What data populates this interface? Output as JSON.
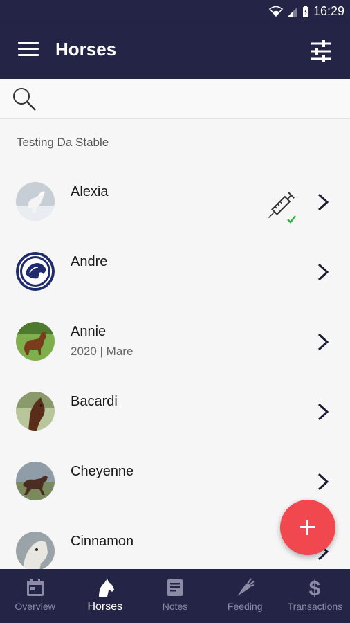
{
  "status_bar": {
    "time": "16:29"
  },
  "app_bar": {
    "title": "Horses"
  },
  "search": {
    "placeholder": ""
  },
  "section": {
    "title": "Testing Da Stable"
  },
  "horses": [
    {
      "name": "Alexia",
      "sub": "",
      "vaccine_done": true
    },
    {
      "name": "Andre",
      "sub": "",
      "vaccine_done": false
    },
    {
      "name": "Annie",
      "sub": "2020 | Mare",
      "vaccine_done": false
    },
    {
      "name": "Bacardi",
      "sub": "",
      "vaccine_done": false
    },
    {
      "name": "Cheyenne",
      "sub": "",
      "vaccine_done": false
    },
    {
      "name": "Cinnamon",
      "sub": "",
      "vaccine_done": false
    }
  ],
  "bottom_nav": {
    "items": [
      {
        "label": "Overview",
        "icon": "calendar-icon",
        "active": false
      },
      {
        "label": "Horses",
        "icon": "horse-head-icon",
        "active": true
      },
      {
        "label": "Notes",
        "icon": "notes-icon",
        "active": false
      },
      {
        "label": "Feeding",
        "icon": "carrot-icon",
        "active": false
      },
      {
        "label": "Transactions",
        "icon": "dollar-icon",
        "active": false
      }
    ]
  },
  "colors": {
    "primary": "#242446",
    "accent": "#f1474f",
    "check": "#2fb344"
  }
}
